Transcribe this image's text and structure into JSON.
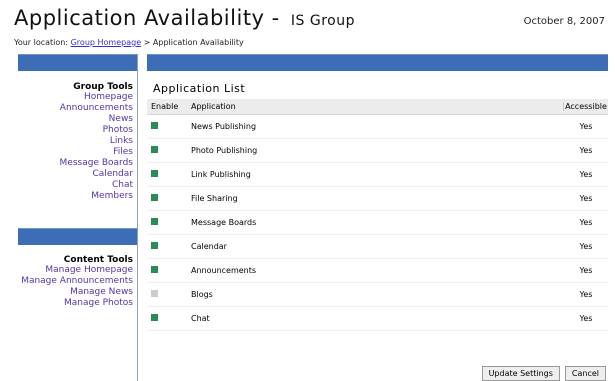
{
  "header": {
    "title": "Application Availability - ",
    "group": "IS Group",
    "date": "October 8, 2007"
  },
  "breadcrumb": {
    "prefix": "Your location: ",
    "link": "Group Homepage",
    "current": " > Application Availability"
  },
  "sidebar": {
    "group_tools_title": "Group Tools",
    "group_tools": [
      "Homepage",
      "Announcements",
      "News",
      "Photos",
      "Links",
      "Files",
      "Message Boards",
      "Calendar",
      "Chat",
      "Members"
    ],
    "content_tools_title": "Content Tools",
    "content_tools": [
      "Manage Homepage",
      "Manage Announcements",
      "Manage News",
      "Manage Photos"
    ]
  },
  "main": {
    "title": "Application List",
    "columns": {
      "enable": "Enable",
      "application": "Application",
      "accessible": "Accessible"
    },
    "rows": [
      {
        "app": "News Publishing",
        "access": "Yes",
        "enabled": true
      },
      {
        "app": "Photo Publishing",
        "access": "Yes",
        "enabled": true
      },
      {
        "app": "Link Publishing",
        "access": "Yes",
        "enabled": true
      },
      {
        "app": "File Sharing",
        "access": "Yes",
        "enabled": true
      },
      {
        "app": "Message Boards",
        "access": "Yes",
        "enabled": true
      },
      {
        "app": "Calendar",
        "access": "Yes",
        "enabled": true
      },
      {
        "app": "Announcements",
        "access": "Yes",
        "enabled": true
      },
      {
        "app": "Blogs",
        "access": "Yes",
        "enabled": false
      },
      {
        "app": "Chat",
        "access": "Yes",
        "enabled": true
      }
    ],
    "buttons": {
      "update": "Update Settings",
      "cancel": "Cancel"
    }
  },
  "colors": {
    "bar": "#3d6db5",
    "link": "#5533aa",
    "check": "#2e8b57"
  }
}
